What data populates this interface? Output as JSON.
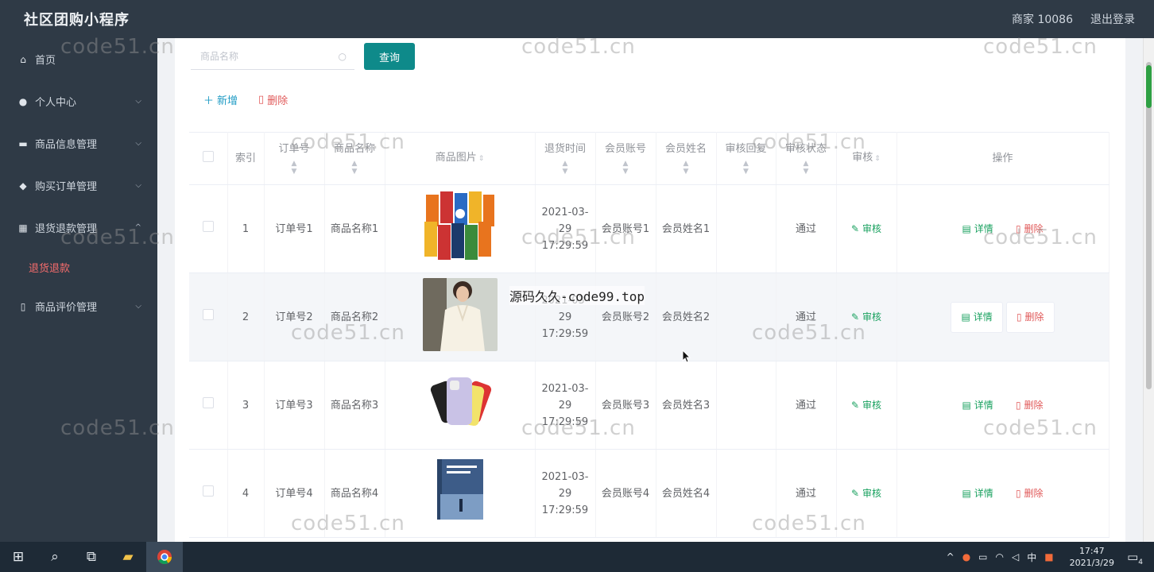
{
  "app": {
    "title": "社区团购小程序",
    "merchant": "商家 10086",
    "logout": "退出登录"
  },
  "sidebar": {
    "items": [
      {
        "label": "首页",
        "icon": "home-icon",
        "glyph": "⌂"
      },
      {
        "label": "个人中心",
        "icon": "user-icon",
        "glyph": "●"
      },
      {
        "label": "商品信息管理",
        "icon": "briefcase-icon",
        "glyph": "▬"
      },
      {
        "label": "购买订单管理",
        "icon": "bulb-icon",
        "glyph": "◆"
      },
      {
        "label": "退货退款管理",
        "icon": "grid-icon",
        "glyph": "▦"
      },
      {
        "label": "商品评价管理",
        "icon": "phone-icon",
        "glyph": "▯"
      }
    ],
    "active_sub": "退货退款"
  },
  "search": {
    "placeholder": "商品名称",
    "button": "查询"
  },
  "actions": {
    "add": "新增",
    "delete": "删除"
  },
  "table": {
    "headers": {
      "index": "索引",
      "order_no": "订单号",
      "product_name": "商品名称",
      "product_image": "商品图片",
      "return_time": "退货时间",
      "member_account": "会员账号",
      "member_name": "会员姓名",
      "audit_reply": "审核回复",
      "audit_status": "审核状态",
      "audit": "审核",
      "operation": "操作"
    },
    "rows": [
      {
        "index": "1",
        "order_no": "订单号1",
        "product_name": "商品名称1",
        "return_time": "2021-03-29 17:29:59",
        "member_account": "会员账号1",
        "member_name": "会员姓名1",
        "audit_reply": "",
        "audit_status": "通过",
        "image": "snack-packets"
      },
      {
        "index": "2",
        "order_no": "订单号2",
        "product_name": "商品名称2",
        "return_time": "2021-03-29 17:29:59",
        "member_account": "会员账号2",
        "member_name": "会员姓名2",
        "audit_reply": "",
        "audit_status": "通过",
        "image": "white-blouse"
      },
      {
        "index": "3",
        "order_no": "订单号3",
        "product_name": "商品名称3",
        "return_time": "2021-03-29 17:29:59",
        "member_account": "会员账号3",
        "member_name": "会员姓名3",
        "audit_reply": "",
        "audit_status": "通过",
        "image": "smartphones"
      },
      {
        "index": "4",
        "order_no": "订单号4",
        "product_name": "商品名称4",
        "return_time": "2021-03-29 17:29:59",
        "member_account": "会员账号4",
        "member_name": "会员姓名4",
        "audit_reply": "",
        "audit_status": "通过",
        "image": "book"
      }
    ],
    "audit_label": "审核",
    "detail_label": "详情",
    "delete_label": "删除"
  },
  "watermarks": {
    "text": "code51.cn",
    "overlay": "源码久久-code99.top"
  },
  "taskbar": {
    "time": "17:47",
    "date": "2021/3/29",
    "ime": "中",
    "badge": "4"
  },
  "colors": {
    "sidebar": "#2f3a46",
    "accent": "#0e8a8a",
    "danger": "#e05858",
    "success": "#19a15f",
    "active_sub": "#f56c6c"
  }
}
